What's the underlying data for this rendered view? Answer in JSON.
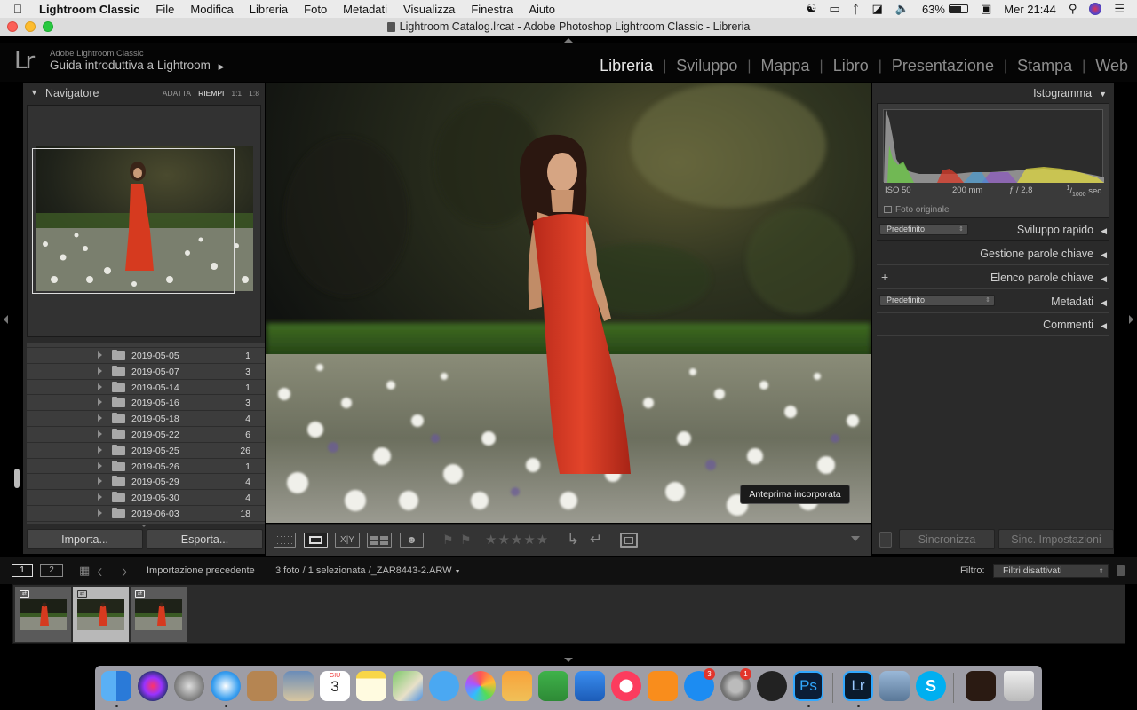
{
  "menubar": {
    "app_name": "Lightroom Classic",
    "items": [
      "File",
      "Modifica",
      "Libreria",
      "Foto",
      "Metadati",
      "Visualizza",
      "Finestra",
      "Aiuto"
    ],
    "battery": "63%",
    "clock": "Mer 21:44"
  },
  "window": {
    "title": "Lightroom Catalog.lrcat - Adobe Photoshop Lightroom Classic - Libreria"
  },
  "identity": {
    "logo": "Lr",
    "product": "Adobe Lightroom Classic",
    "catalog": "Guida introduttiva a Lightroom"
  },
  "modules": [
    "Libreria",
    "Sviluppo",
    "Mappa",
    "Libro",
    "Presentazione",
    "Stampa",
    "Web"
  ],
  "navigator": {
    "title": "Navigatore",
    "options": [
      "ADATTA",
      "RIEMPI",
      "1:1",
      "1:8"
    ],
    "selected_option": "RIEMPI"
  },
  "folders": [
    {
      "name": "2019-05-05",
      "count": "1"
    },
    {
      "name": "2019-05-07",
      "count": "3"
    },
    {
      "name": "2019-05-14",
      "count": "1"
    },
    {
      "name": "2019-05-16",
      "count": "3"
    },
    {
      "name": "2019-05-18",
      "count": "4"
    },
    {
      "name": "2019-05-22",
      "count": "6"
    },
    {
      "name": "2019-05-25",
      "count": "26"
    },
    {
      "name": "2019-05-26",
      "count": "1"
    },
    {
      "name": "2019-05-29",
      "count": "4"
    },
    {
      "name": "2019-05-30",
      "count": "4"
    },
    {
      "name": "2019-06-03",
      "count": "18"
    }
  ],
  "left_buttons": {
    "import": "Importa...",
    "export": "Esporta..."
  },
  "loupe": {
    "tooltip": "Anteprima incorporata"
  },
  "histogram": {
    "title": "Istogramma",
    "iso": "ISO 50",
    "focal": "200 mm",
    "aperture": "ƒ / 2,8",
    "shutter_num": "1",
    "shutter_den": "1000",
    "shutter_unit": "sec",
    "original_photo": "Foto originale"
  },
  "right_panels": {
    "quick_develop": "Sviluppo rapido",
    "quick_develop_preset": "Predefinito",
    "keywording": "Gestione parole chiave",
    "keyword_list": "Elenco parole chiave",
    "keyword_list_add": "+",
    "metadata": "Metadati",
    "metadata_preset": "Predefinito",
    "comments": "Commenti"
  },
  "right_buttons": {
    "sync": "Sincronizza",
    "sync_settings": "Sinc. Impostazioni"
  },
  "filmstrip": {
    "view1": "1",
    "view2": "2",
    "source": "Importazione precedente",
    "info": "3 foto / 1 selezionata /",
    "filename": "_ZAR8443-2.ARW",
    "filter_label": "Filtro:",
    "filter_value": "Filtri disattivati",
    "thumbnails": 3,
    "selected_index": 1
  },
  "dock": {
    "calendar_month": "GIU",
    "calendar_day": "3",
    "badges": [
      "3",
      "1"
    ],
    "ps_label": "Ps",
    "lr_label": "Lr"
  },
  "colors": {
    "accent_active": "#e8e8e8",
    "panel_bg": "#2a2a2a",
    "dress_red": "#d63a1f"
  }
}
